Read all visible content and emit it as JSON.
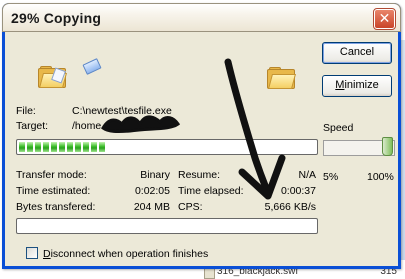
{
  "window": {
    "title": "29% Copying",
    "close_glyph": "✕"
  },
  "buttons": {
    "cancel": "Cancel",
    "minimize": "Minimize"
  },
  "file": {
    "file_label": "File:",
    "file_value": "C:\\newtest\\tesfile.exe",
    "target_label": "Target:",
    "target_value": "/home"
  },
  "progress": {
    "file_fraction": 0.31,
    "total_fraction": 0.0
  },
  "speed": {
    "label": "Speed",
    "min_label": "5%",
    "max_label": "100%",
    "value_fraction": 0.95
  },
  "stats": {
    "transfer_mode_label": "Transfer mode:",
    "transfer_mode_value": "Binary",
    "resume_label": "Resume:",
    "resume_value": "N/A",
    "time_estimated_label": "Time estimated:",
    "time_estimated_value": "0:02:05",
    "time_elapsed_label": "Time elapsed:",
    "time_elapsed_value": "0:00:37",
    "bytes_label": "Bytes transfered:",
    "bytes_value": "204 MB",
    "cps_label": "CPS:",
    "cps_value": "5,666 KB/s"
  },
  "options": {
    "disconnect_label": "Disconnect when operation finishes",
    "disconnect_checked": false
  },
  "background": {
    "row_name": "316_blackjack.swf",
    "row_size": "315"
  },
  "colors": {
    "title_bar": "#ece9d8",
    "close_button": "#c94429",
    "progress_green": "#3bbd2a"
  }
}
